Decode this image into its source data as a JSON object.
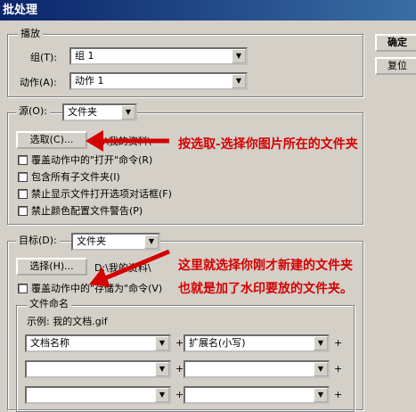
{
  "window": {
    "title": "批处理"
  },
  "buttons": {
    "ok": "确定",
    "reset": "复位"
  },
  "play": {
    "legend": "播放",
    "set_label": "组(T):",
    "set_value": "组 1",
    "action_label": "动作(A):",
    "action_value": "动作 1"
  },
  "source": {
    "label": "源(O):",
    "value": "文件夹",
    "choose_button": "选取(C)...",
    "path": "D:\\我的资料\\",
    "checkboxes": [
      "覆盖动作中的\"打开\"命令(R)",
      "包含所有子文件夹(I)",
      "禁止显示文件打开选项对话框(F)",
      "禁止颜色配置文件警告(P)"
    ]
  },
  "destination": {
    "label": "目标(D):",
    "value": "文件夹",
    "choose_button": "选择(H)...",
    "path": "D:\\我的资料\\",
    "override_checkbox": "覆盖动作中的\"存储为\"命令(V)"
  },
  "file_naming": {
    "legend": "文件命名",
    "example": "示例: 我的文档.gif",
    "rows": [
      {
        "left": "文档名称",
        "right": "扩展名(小写)"
      },
      {
        "left": "",
        "right": ""
      },
      {
        "left": "",
        "right": ""
      }
    ]
  },
  "annotations": {
    "source_note": "按选取-选择你图片所在的文件夹",
    "dest_note_1": "这里就选择你刚才新建的文件夹",
    "dest_note_2": "也就是加了水印要放的文件夹。"
  },
  "colors": {
    "annotation": "#d40000",
    "title_bar": "#0a246a"
  }
}
